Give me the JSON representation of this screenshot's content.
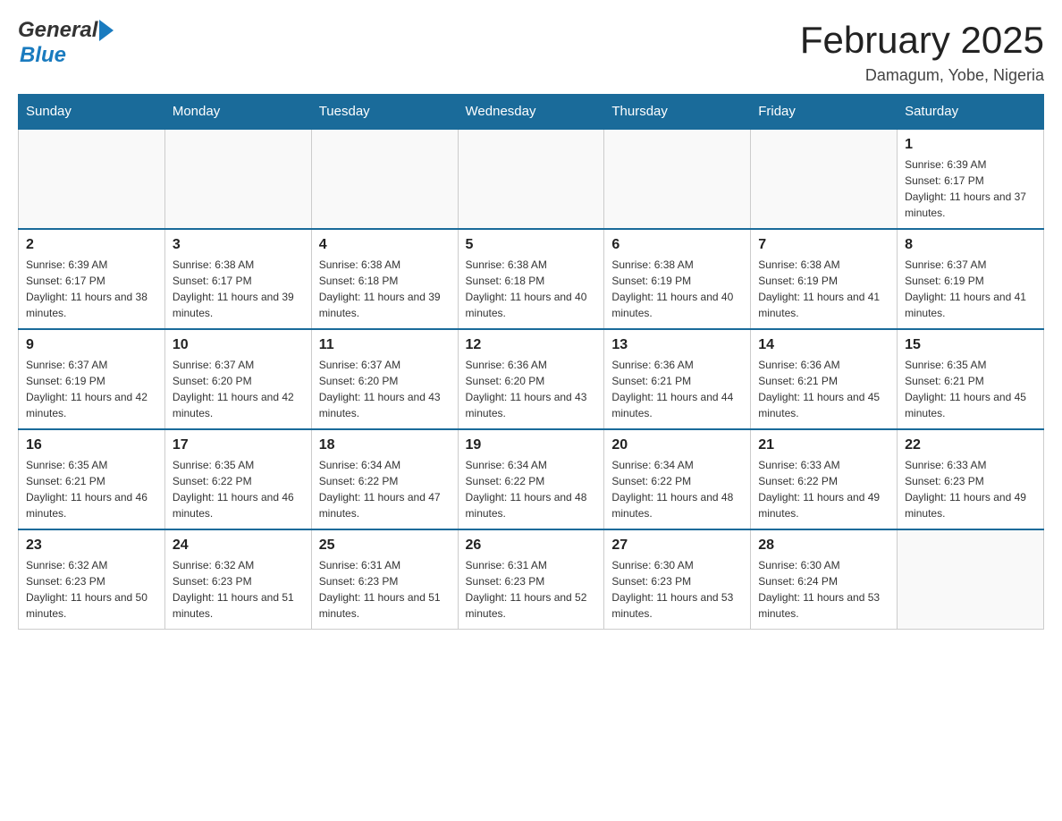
{
  "header": {
    "month_title": "February 2025",
    "location": "Damagum, Yobe, Nigeria",
    "logo_general": "General",
    "logo_blue": "Blue"
  },
  "weekdays": [
    "Sunday",
    "Monday",
    "Tuesday",
    "Wednesday",
    "Thursday",
    "Friday",
    "Saturday"
  ],
  "days": {
    "1": {
      "num": "1",
      "sunrise": "Sunrise: 6:39 AM",
      "sunset": "Sunset: 6:17 PM",
      "daylight": "Daylight: 11 hours and 37 minutes."
    },
    "2": {
      "num": "2",
      "sunrise": "Sunrise: 6:39 AM",
      "sunset": "Sunset: 6:17 PM",
      "daylight": "Daylight: 11 hours and 38 minutes."
    },
    "3": {
      "num": "3",
      "sunrise": "Sunrise: 6:38 AM",
      "sunset": "Sunset: 6:17 PM",
      "daylight": "Daylight: 11 hours and 39 minutes."
    },
    "4": {
      "num": "4",
      "sunrise": "Sunrise: 6:38 AM",
      "sunset": "Sunset: 6:18 PM",
      "daylight": "Daylight: 11 hours and 39 minutes."
    },
    "5": {
      "num": "5",
      "sunrise": "Sunrise: 6:38 AM",
      "sunset": "Sunset: 6:18 PM",
      "daylight": "Daylight: 11 hours and 40 minutes."
    },
    "6": {
      "num": "6",
      "sunrise": "Sunrise: 6:38 AM",
      "sunset": "Sunset: 6:19 PM",
      "daylight": "Daylight: 11 hours and 40 minutes."
    },
    "7": {
      "num": "7",
      "sunrise": "Sunrise: 6:38 AM",
      "sunset": "Sunset: 6:19 PM",
      "daylight": "Daylight: 11 hours and 41 minutes."
    },
    "8": {
      "num": "8",
      "sunrise": "Sunrise: 6:37 AM",
      "sunset": "Sunset: 6:19 PM",
      "daylight": "Daylight: 11 hours and 41 minutes."
    },
    "9": {
      "num": "9",
      "sunrise": "Sunrise: 6:37 AM",
      "sunset": "Sunset: 6:19 PM",
      "daylight": "Daylight: 11 hours and 42 minutes."
    },
    "10": {
      "num": "10",
      "sunrise": "Sunrise: 6:37 AM",
      "sunset": "Sunset: 6:20 PM",
      "daylight": "Daylight: 11 hours and 42 minutes."
    },
    "11": {
      "num": "11",
      "sunrise": "Sunrise: 6:37 AM",
      "sunset": "Sunset: 6:20 PM",
      "daylight": "Daylight: 11 hours and 43 minutes."
    },
    "12": {
      "num": "12",
      "sunrise": "Sunrise: 6:36 AM",
      "sunset": "Sunset: 6:20 PM",
      "daylight": "Daylight: 11 hours and 43 minutes."
    },
    "13": {
      "num": "13",
      "sunrise": "Sunrise: 6:36 AM",
      "sunset": "Sunset: 6:21 PM",
      "daylight": "Daylight: 11 hours and 44 minutes."
    },
    "14": {
      "num": "14",
      "sunrise": "Sunrise: 6:36 AM",
      "sunset": "Sunset: 6:21 PM",
      "daylight": "Daylight: 11 hours and 45 minutes."
    },
    "15": {
      "num": "15",
      "sunrise": "Sunrise: 6:35 AM",
      "sunset": "Sunset: 6:21 PM",
      "daylight": "Daylight: 11 hours and 45 minutes."
    },
    "16": {
      "num": "16",
      "sunrise": "Sunrise: 6:35 AM",
      "sunset": "Sunset: 6:21 PM",
      "daylight": "Daylight: 11 hours and 46 minutes."
    },
    "17": {
      "num": "17",
      "sunrise": "Sunrise: 6:35 AM",
      "sunset": "Sunset: 6:22 PM",
      "daylight": "Daylight: 11 hours and 46 minutes."
    },
    "18": {
      "num": "18",
      "sunrise": "Sunrise: 6:34 AM",
      "sunset": "Sunset: 6:22 PM",
      "daylight": "Daylight: 11 hours and 47 minutes."
    },
    "19": {
      "num": "19",
      "sunrise": "Sunrise: 6:34 AM",
      "sunset": "Sunset: 6:22 PM",
      "daylight": "Daylight: 11 hours and 48 minutes."
    },
    "20": {
      "num": "20",
      "sunrise": "Sunrise: 6:34 AM",
      "sunset": "Sunset: 6:22 PM",
      "daylight": "Daylight: 11 hours and 48 minutes."
    },
    "21": {
      "num": "21",
      "sunrise": "Sunrise: 6:33 AM",
      "sunset": "Sunset: 6:22 PM",
      "daylight": "Daylight: 11 hours and 49 minutes."
    },
    "22": {
      "num": "22",
      "sunrise": "Sunrise: 6:33 AM",
      "sunset": "Sunset: 6:23 PM",
      "daylight": "Daylight: 11 hours and 49 minutes."
    },
    "23": {
      "num": "23",
      "sunrise": "Sunrise: 6:32 AM",
      "sunset": "Sunset: 6:23 PM",
      "daylight": "Daylight: 11 hours and 50 minutes."
    },
    "24": {
      "num": "24",
      "sunrise": "Sunrise: 6:32 AM",
      "sunset": "Sunset: 6:23 PM",
      "daylight": "Daylight: 11 hours and 51 minutes."
    },
    "25": {
      "num": "25",
      "sunrise": "Sunrise: 6:31 AM",
      "sunset": "Sunset: 6:23 PM",
      "daylight": "Daylight: 11 hours and 51 minutes."
    },
    "26": {
      "num": "26",
      "sunrise": "Sunrise: 6:31 AM",
      "sunset": "Sunset: 6:23 PM",
      "daylight": "Daylight: 11 hours and 52 minutes."
    },
    "27": {
      "num": "27",
      "sunrise": "Sunrise: 6:30 AM",
      "sunset": "Sunset: 6:23 PM",
      "daylight": "Daylight: 11 hours and 53 minutes."
    },
    "28": {
      "num": "28",
      "sunrise": "Sunrise: 6:30 AM",
      "sunset": "Sunset: 6:24 PM",
      "daylight": "Daylight: 11 hours and 53 minutes."
    }
  }
}
